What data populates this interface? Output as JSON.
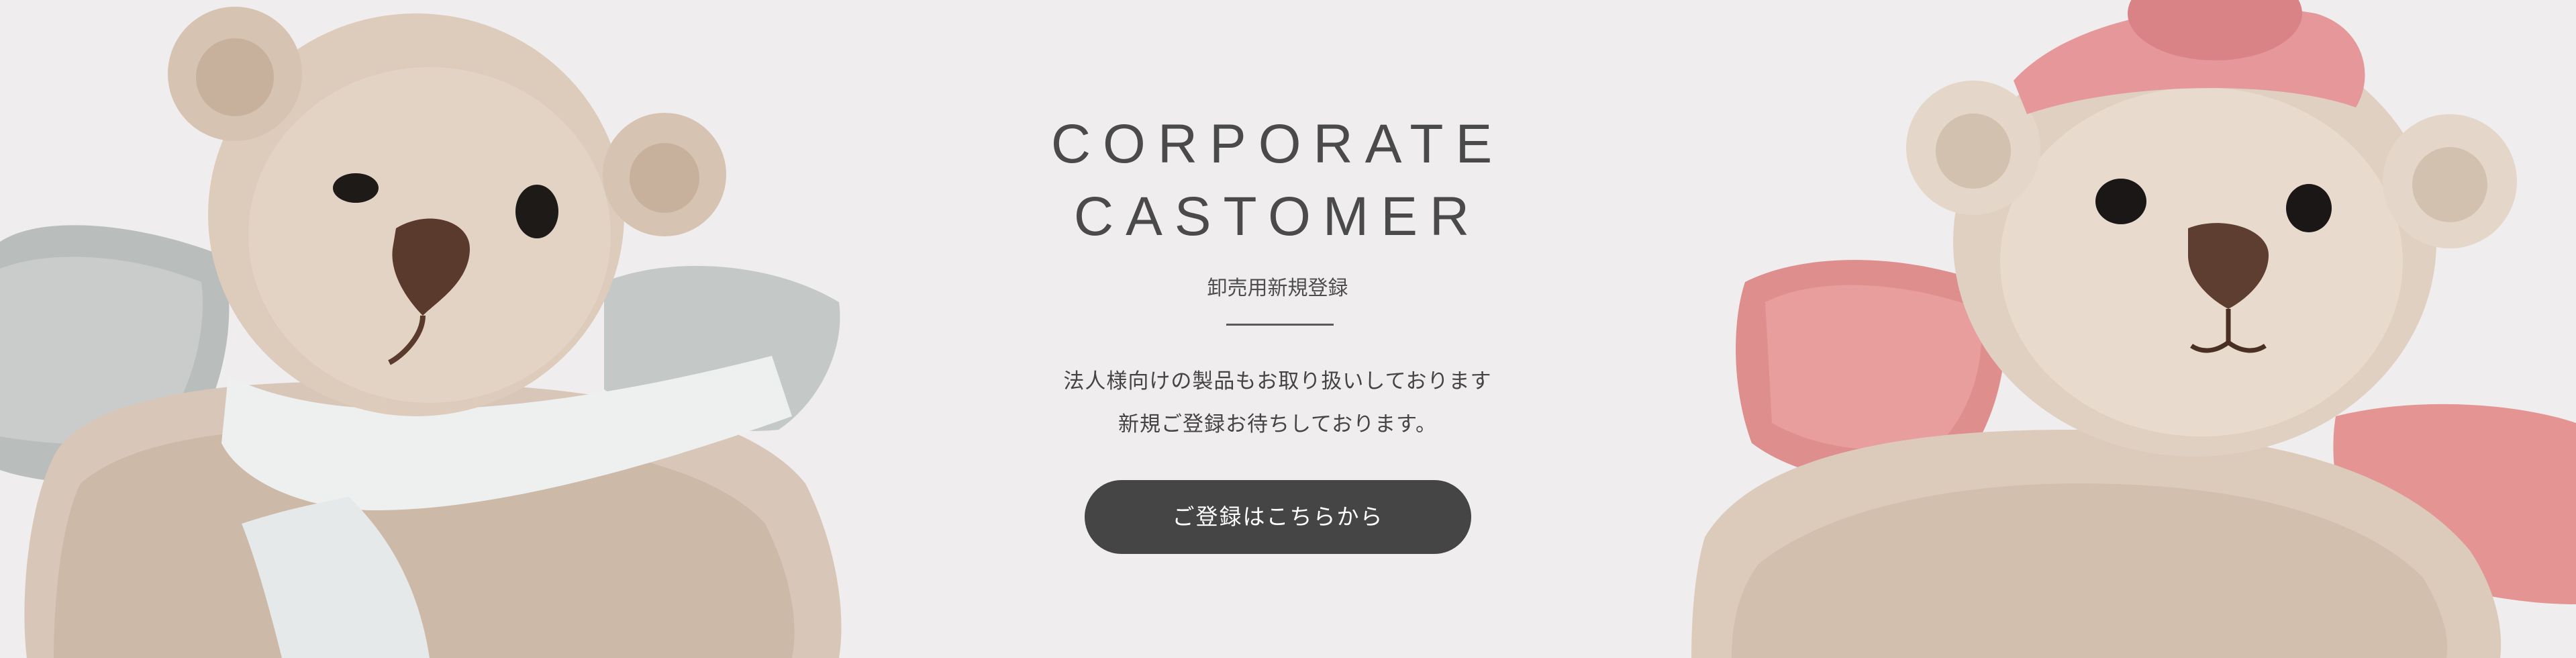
{
  "hero": {
    "title_line1": "CORPORATE",
    "title_line2": "CASTOMER",
    "subtitle": "卸売用新規登録",
    "description_line1": "法人様向けの製品もお取り扱いしております",
    "description_line2": "新規ご登録お待ちしております。",
    "cta_label": "ご登録はこちらから"
  },
  "images": {
    "left": "teddy-bear-with-grey-wings-and-scarf",
    "right": "teddy-bear-with-pink-wings-and-hat"
  },
  "colors": {
    "background": "#efeded",
    "text": "#454545",
    "button": "#454545",
    "button_text": "#ffffff"
  }
}
